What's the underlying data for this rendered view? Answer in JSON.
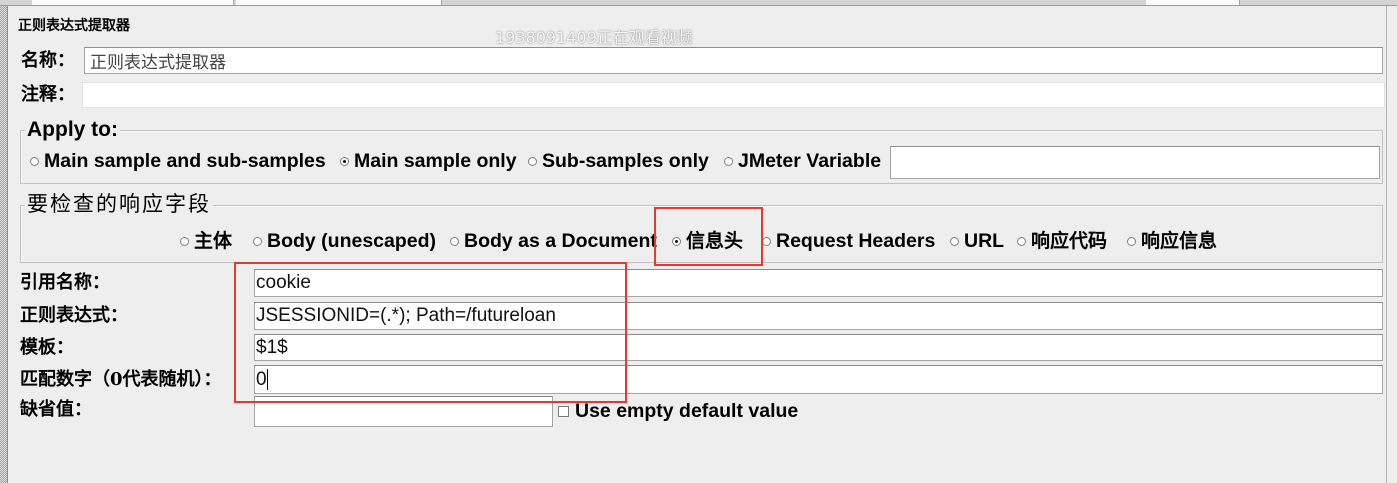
{
  "window": {
    "title": "正则表达式提取器",
    "watermark": "1938091409正在观看视频"
  },
  "name": {
    "label": "名称：",
    "value": "正则表达式提取器"
  },
  "comments": {
    "label": "注释：",
    "value": ""
  },
  "apply_to": {
    "title": "Apply to:",
    "options": [
      {
        "label": "Main sample and sub-samples",
        "selected": false
      },
      {
        "label": "Main sample only",
        "selected": true
      },
      {
        "label": "Sub-samples only",
        "selected": false
      },
      {
        "label": "JMeter Variable",
        "selected": false
      }
    ],
    "jmeter_variable_value": ""
  },
  "field_to_check": {
    "title": "要检查的响应字段",
    "options": [
      {
        "label": "主体",
        "selected": false
      },
      {
        "label": "Body (unescaped)",
        "selected": false
      },
      {
        "label": "Body as a Document",
        "selected": false
      },
      {
        "label": "信息头",
        "selected": true
      },
      {
        "label": "Request Headers",
        "selected": false
      },
      {
        "label": "URL",
        "selected": false
      },
      {
        "label": "响应代码",
        "selected": false
      },
      {
        "label": "响应信息",
        "selected": false
      }
    ]
  },
  "extractor_fields": [
    {
      "label": "引用名称：",
      "value": "cookie"
    },
    {
      "label": "正则表达式：",
      "value": "JSESSIONID=(.*); Path=/futureloan"
    },
    {
      "label": "模板：",
      "value": "$1$"
    },
    {
      "label": "匹配数字（0代表随机）：",
      "value": "0"
    },
    {
      "label": "缺省值：",
      "value": ""
    }
  ],
  "empty_default": {
    "label": "Use empty default value",
    "checked": false
  },
  "icons": {
    "radio": "radio-button-icon",
    "checkbox": "checkbox-icon"
  },
  "colors": {
    "panel_background": "#eeeeee",
    "field_background": "#ffffff",
    "highlight_annotation": "#e53935",
    "text": "#000000"
  }
}
